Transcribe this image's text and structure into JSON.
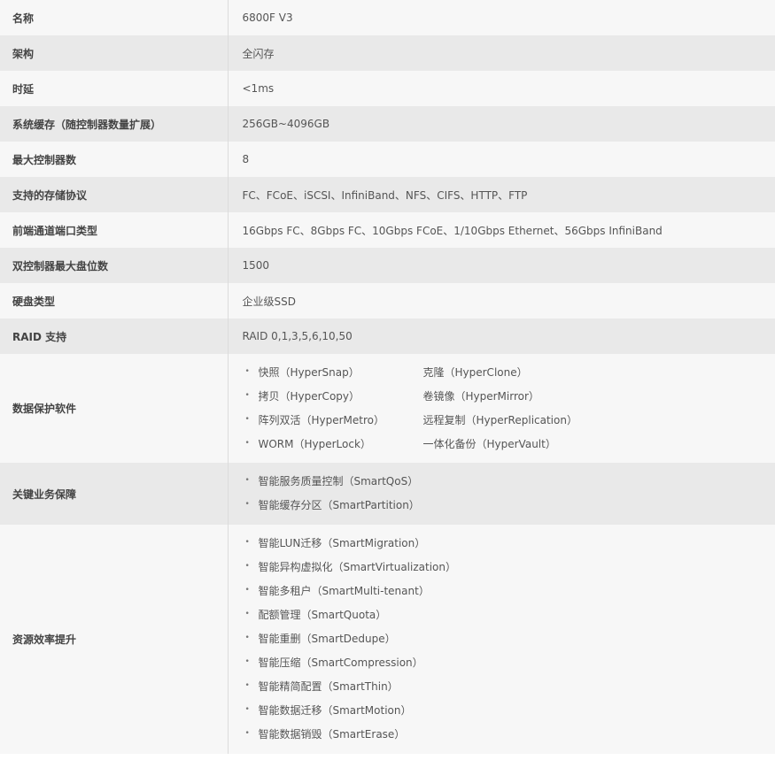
{
  "rows": [
    {
      "key": "名称",
      "value": "6800F V3"
    },
    {
      "key": "架构",
      "value": "全闪存"
    },
    {
      "key": "时延",
      "value": "<1ms"
    },
    {
      "key": "系统缓存（随控制器数量扩展）",
      "value": "256GB~4096GB"
    },
    {
      "key": "最大控制器数",
      "value": "8"
    },
    {
      "key": "支持的存储协议",
      "value": "FC、FCoE、iSCSI、InfiniBand、NFS、CIFS、HTTP、FTP"
    },
    {
      "key": "前端通道端口类型",
      "value": "16Gbps FC、8Gbps FC、10Gbps FCoE、1/10Gbps Ethernet、56Gbps InfiniBand"
    },
    {
      "key": "双控制器最大盘位数",
      "value": "1500"
    },
    {
      "key": "硬盘类型",
      "value": "企业级SSD"
    },
    {
      "key": "RAID 支持",
      "value": "RAID 0,1,3,5,6,10,50"
    }
  ],
  "data_protection": {
    "key": "数据保护软件",
    "col1": [
      "快照（HyperSnap）",
      "拷贝（HyperCopy）",
      "阵列双活（HyperMetro）",
      "WORM（HyperLock）"
    ],
    "col2": [
      "克隆（HyperClone）",
      "卷镜像（HyperMirror）",
      "远程复制（HyperReplication）",
      "一体化备份（HyperVault）"
    ]
  },
  "business_continuity": {
    "key": "关键业务保障",
    "items": [
      "智能服务质量控制（SmartQoS）",
      "智能缓存分区（SmartPartition）"
    ]
  },
  "resource_efficiency": {
    "key": "资源效率提升",
    "items": [
      "智能LUN迁移（SmartMigration）",
      "智能异构虚拟化（SmartVirtualization）",
      "智能多租户（SmartMulti-tenant）",
      "配额管理（SmartQuota）",
      "智能重删（SmartDedupe）",
      "智能压缩（SmartCompression）",
      "智能精简配置（SmartThin）",
      "智能数据迁移（SmartMotion）",
      "智能数据销毁（SmartErase）"
    ]
  }
}
